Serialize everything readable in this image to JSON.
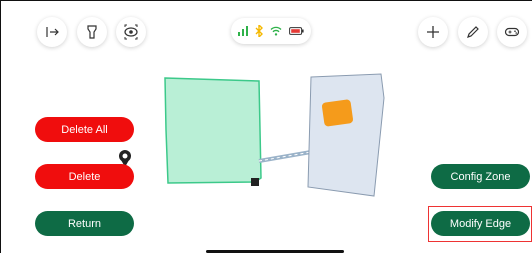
{
  "toolbar_left": {
    "exit_icon": "exit-icon",
    "brush_icon": "brush-icon",
    "eye_icon": "eye-scan-icon"
  },
  "status": {
    "signal_icon": "signal-icon",
    "bluetooth_icon": "bluetooth-icon",
    "wifi_icon": "wifi-icon",
    "battery_icon": "battery-icon",
    "colors": {
      "signal": "#2fb24a",
      "bluetooth": "#f5b800",
      "wifi": "#2fb24a",
      "battery": "#e53935"
    }
  },
  "toolbar_right": {
    "add_icon": "plus-icon",
    "edit_icon": "pencil-icon",
    "gamepad_icon": "gamepad-icon"
  },
  "buttons": {
    "delete_all": "Delete All",
    "delete": "Delete",
    "return": "Return",
    "config_zone": "Config Zone",
    "modify_edge": "Modify Edge"
  },
  "colors": {
    "red": "#f00d0d",
    "green": "#0e6b45",
    "zone_fill": "#b9efd6",
    "zone_stroke": "#3cc98a",
    "station_fill": "#dde5f0",
    "dock_orange": "#f59b1b"
  }
}
